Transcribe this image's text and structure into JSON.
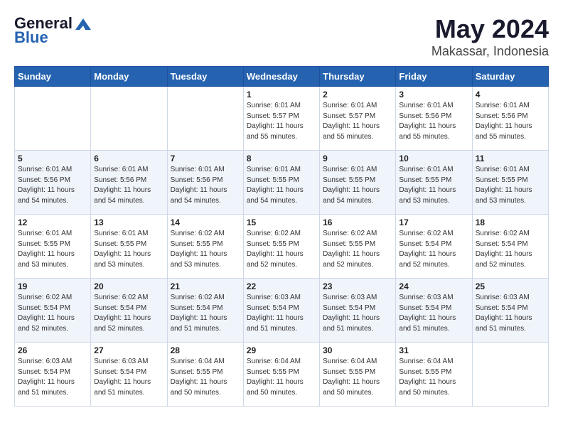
{
  "header": {
    "logo_line1": "General",
    "logo_line2": "Blue",
    "title": "May 2024",
    "subtitle": "Makassar, Indonesia"
  },
  "weekdays": [
    "Sunday",
    "Monday",
    "Tuesday",
    "Wednesday",
    "Thursday",
    "Friday",
    "Saturday"
  ],
  "weeks": [
    [
      {
        "day": "",
        "content": ""
      },
      {
        "day": "",
        "content": ""
      },
      {
        "day": "",
        "content": ""
      },
      {
        "day": "1",
        "content": "Sunrise: 6:01 AM\nSunset: 5:57 PM\nDaylight: 11 hours\nand 55 minutes."
      },
      {
        "day": "2",
        "content": "Sunrise: 6:01 AM\nSunset: 5:57 PM\nDaylight: 11 hours\nand 55 minutes."
      },
      {
        "day": "3",
        "content": "Sunrise: 6:01 AM\nSunset: 5:56 PM\nDaylight: 11 hours\nand 55 minutes."
      },
      {
        "day": "4",
        "content": "Sunrise: 6:01 AM\nSunset: 5:56 PM\nDaylight: 11 hours\nand 55 minutes."
      }
    ],
    [
      {
        "day": "5",
        "content": "Sunrise: 6:01 AM\nSunset: 5:56 PM\nDaylight: 11 hours\nand 54 minutes."
      },
      {
        "day": "6",
        "content": "Sunrise: 6:01 AM\nSunset: 5:56 PM\nDaylight: 11 hours\nand 54 minutes."
      },
      {
        "day": "7",
        "content": "Sunrise: 6:01 AM\nSunset: 5:56 PM\nDaylight: 11 hours\nand 54 minutes."
      },
      {
        "day": "8",
        "content": "Sunrise: 6:01 AM\nSunset: 5:55 PM\nDaylight: 11 hours\nand 54 minutes."
      },
      {
        "day": "9",
        "content": "Sunrise: 6:01 AM\nSunset: 5:55 PM\nDaylight: 11 hours\nand 54 minutes."
      },
      {
        "day": "10",
        "content": "Sunrise: 6:01 AM\nSunset: 5:55 PM\nDaylight: 11 hours\nand 53 minutes."
      },
      {
        "day": "11",
        "content": "Sunrise: 6:01 AM\nSunset: 5:55 PM\nDaylight: 11 hours\nand 53 minutes."
      }
    ],
    [
      {
        "day": "12",
        "content": "Sunrise: 6:01 AM\nSunset: 5:55 PM\nDaylight: 11 hours\nand 53 minutes."
      },
      {
        "day": "13",
        "content": "Sunrise: 6:01 AM\nSunset: 5:55 PM\nDaylight: 11 hours\nand 53 minutes."
      },
      {
        "day": "14",
        "content": "Sunrise: 6:02 AM\nSunset: 5:55 PM\nDaylight: 11 hours\nand 53 minutes."
      },
      {
        "day": "15",
        "content": "Sunrise: 6:02 AM\nSunset: 5:55 PM\nDaylight: 11 hours\nand 52 minutes."
      },
      {
        "day": "16",
        "content": "Sunrise: 6:02 AM\nSunset: 5:55 PM\nDaylight: 11 hours\nand 52 minutes."
      },
      {
        "day": "17",
        "content": "Sunrise: 6:02 AM\nSunset: 5:54 PM\nDaylight: 11 hours\nand 52 minutes."
      },
      {
        "day": "18",
        "content": "Sunrise: 6:02 AM\nSunset: 5:54 PM\nDaylight: 11 hours\nand 52 minutes."
      }
    ],
    [
      {
        "day": "19",
        "content": "Sunrise: 6:02 AM\nSunset: 5:54 PM\nDaylight: 11 hours\nand 52 minutes."
      },
      {
        "day": "20",
        "content": "Sunrise: 6:02 AM\nSunset: 5:54 PM\nDaylight: 11 hours\nand 52 minutes."
      },
      {
        "day": "21",
        "content": "Sunrise: 6:02 AM\nSunset: 5:54 PM\nDaylight: 11 hours\nand 51 minutes."
      },
      {
        "day": "22",
        "content": "Sunrise: 6:03 AM\nSunset: 5:54 PM\nDaylight: 11 hours\nand 51 minutes."
      },
      {
        "day": "23",
        "content": "Sunrise: 6:03 AM\nSunset: 5:54 PM\nDaylight: 11 hours\nand 51 minutes."
      },
      {
        "day": "24",
        "content": "Sunrise: 6:03 AM\nSunset: 5:54 PM\nDaylight: 11 hours\nand 51 minutes."
      },
      {
        "day": "25",
        "content": "Sunrise: 6:03 AM\nSunset: 5:54 PM\nDaylight: 11 hours\nand 51 minutes."
      }
    ],
    [
      {
        "day": "26",
        "content": "Sunrise: 6:03 AM\nSunset: 5:54 PM\nDaylight: 11 hours\nand 51 minutes."
      },
      {
        "day": "27",
        "content": "Sunrise: 6:03 AM\nSunset: 5:54 PM\nDaylight: 11 hours\nand 51 minutes."
      },
      {
        "day": "28",
        "content": "Sunrise: 6:04 AM\nSunset: 5:55 PM\nDaylight: 11 hours\nand 50 minutes."
      },
      {
        "day": "29",
        "content": "Sunrise: 6:04 AM\nSunset: 5:55 PM\nDaylight: 11 hours\nand 50 minutes."
      },
      {
        "day": "30",
        "content": "Sunrise: 6:04 AM\nSunset: 5:55 PM\nDaylight: 11 hours\nand 50 minutes."
      },
      {
        "day": "31",
        "content": "Sunrise: 6:04 AM\nSunset: 5:55 PM\nDaylight: 11 hours\nand 50 minutes."
      },
      {
        "day": "",
        "content": ""
      }
    ]
  ]
}
